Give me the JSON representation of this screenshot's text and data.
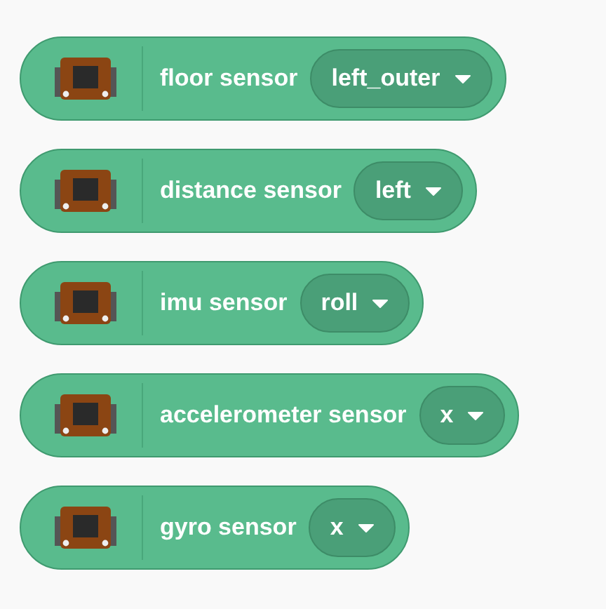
{
  "blocks": [
    {
      "label": "floor sensor",
      "dropdown": "left_outer"
    },
    {
      "label": "distance sensor",
      "dropdown": "left"
    },
    {
      "label": "imu sensor",
      "dropdown": "roll"
    },
    {
      "label": "accelerometer sensor",
      "dropdown": "x"
    },
    {
      "label": "gyro sensor",
      "dropdown": "x"
    }
  ]
}
